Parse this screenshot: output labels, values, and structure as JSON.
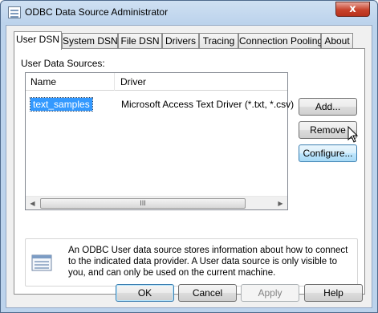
{
  "window": {
    "title": "ODBC Data Source Administrator",
    "close_glyph": "x"
  },
  "tabs": [
    {
      "label": "User DSN",
      "active": true
    },
    {
      "label": "System DSN",
      "active": false
    },
    {
      "label": "File DSN",
      "active": false
    },
    {
      "label": "Drivers",
      "active": false
    },
    {
      "label": "Tracing",
      "active": false
    },
    {
      "label": "Connection Pooling",
      "active": false
    },
    {
      "label": "About",
      "active": false
    }
  ],
  "user_dsn": {
    "section_label": "User Data Sources:",
    "columns": [
      "Name",
      "Driver"
    ],
    "rows": [
      {
        "name": "text_samples",
        "driver": "Microsoft Access Text Driver (*.txt, *.csv)",
        "selected": true
      }
    ],
    "scrollbar": {
      "left_arrow": "◀",
      "right_arrow": "▶",
      "thumb_grip": "III"
    },
    "buttons": {
      "add": "Add...",
      "remove": "Remove",
      "configure": "Configure..."
    },
    "info_text": "An ODBC User data source stores information about how to connect to the indicated data provider.   A User data source is only visible to you, and can only be used on the current machine."
  },
  "footer": {
    "ok": "OK",
    "cancel": "Cancel",
    "apply": "Apply",
    "help": "Help"
  },
  "colors": {
    "selection": "#3399ff",
    "close_button": "#c7422b",
    "title_bar": "#bcd3ec"
  }
}
